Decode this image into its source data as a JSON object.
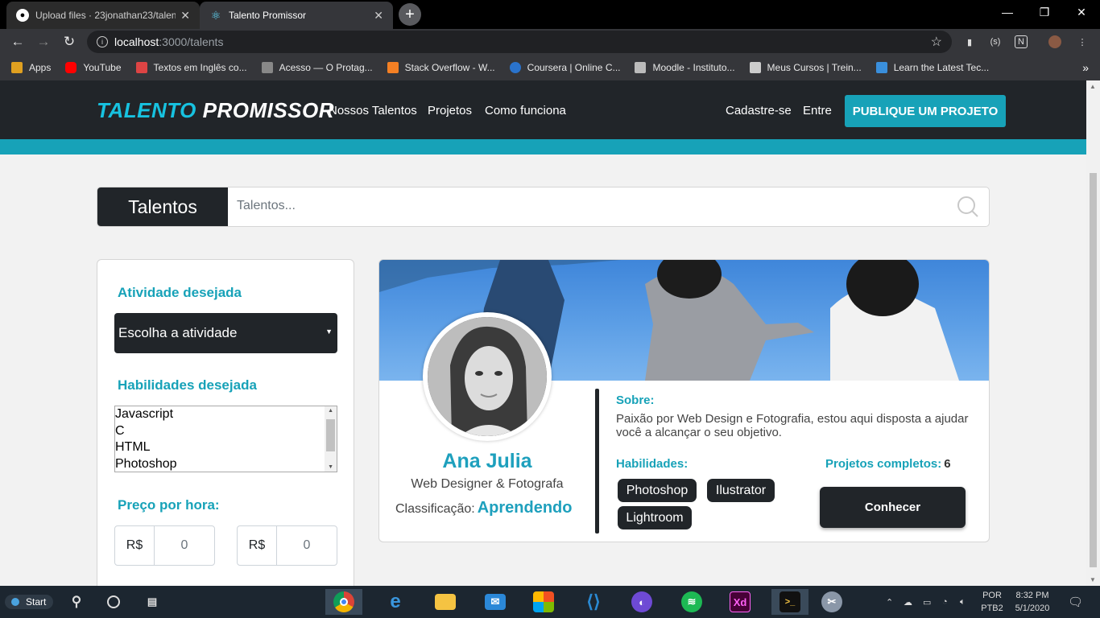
{
  "browser": {
    "tabs": [
      {
        "title": "Upload files · 23jonathan23/talen",
        "icon": "github-icon"
      },
      {
        "title": "Talento Promissor",
        "icon": "react-icon"
      }
    ],
    "url_host": "localhost",
    "url_path": ":3000/talents",
    "bookmarks": [
      {
        "label": "Apps",
        "icon": "apps-grid-icon",
        "color": "#e0a020"
      },
      {
        "label": "YouTube",
        "icon": "youtube-icon",
        "color": "#ff0000"
      },
      {
        "label": "Textos em Inglês co...",
        "icon": "bookmark-icon",
        "color": "#d44"
      },
      {
        "label": "Acesso — O Protag...",
        "icon": "bookmark-icon",
        "color": "#888"
      },
      {
        "label": "Stack Overflow - W...",
        "icon": "stackoverflow-icon",
        "color": "#f48024"
      },
      {
        "label": "Coursera | Online C...",
        "icon": "coursera-icon",
        "color": "#2a73cc"
      },
      {
        "label": "Moodle - Instituto...",
        "icon": "moodle-icon",
        "color": "#bbb"
      },
      {
        "label": "Meus Cursos | Trein...",
        "icon": "bookmark-icon",
        "color": "#ccc"
      },
      {
        "label": "Learn the Latest Tec...",
        "icon": "udemy-icon",
        "color": "#3a8fdc"
      }
    ]
  },
  "site": {
    "logo_part1": "TALENTO",
    "logo_part2": "PROMISSOR",
    "nav": [
      "Nossos Talentos",
      "Projetos",
      "Como funciona"
    ],
    "signup": "Cadastre-se",
    "login": "Entre",
    "publish": "PUBLIQUE UM PROJETO",
    "accent_color": "#17a2b8",
    "dark_color": "#212529"
  },
  "search": {
    "label": "Talentos",
    "placeholder": "Talentos..."
  },
  "filters": {
    "activity_title": "Atividade desejada",
    "activity_select": "Escolha a atividade",
    "skills_title": "Habilidades desejada",
    "skills_options": [
      "Javascript",
      "C",
      "HTML",
      "Photoshop"
    ],
    "price_title": "Preço por hora:",
    "currency": "R$",
    "price_min": "0",
    "price_max": "0"
  },
  "talent": {
    "name": "Ana Julia",
    "role": "Web Designer & Fotografa",
    "rank_label": "Classificação:",
    "rank_value": "Aprendendo",
    "about_title": "Sobre:",
    "about_text": "Paixão por Web Design e Fotografia, estou aqui disposta a ajudar você a alcançar o seu objetivo.",
    "skills_title": "Habilidades:",
    "skills": [
      "Photoshop",
      "Ilustrator",
      "Lightroom"
    ],
    "projects_label": "Projetos completos:",
    "projects_value": "6",
    "button": "Conhecer"
  },
  "taskbar": {
    "start": "Start",
    "lang1": "POR",
    "lang2": "PTB2",
    "time": "8:32 PM",
    "date": "5/1/2020"
  }
}
